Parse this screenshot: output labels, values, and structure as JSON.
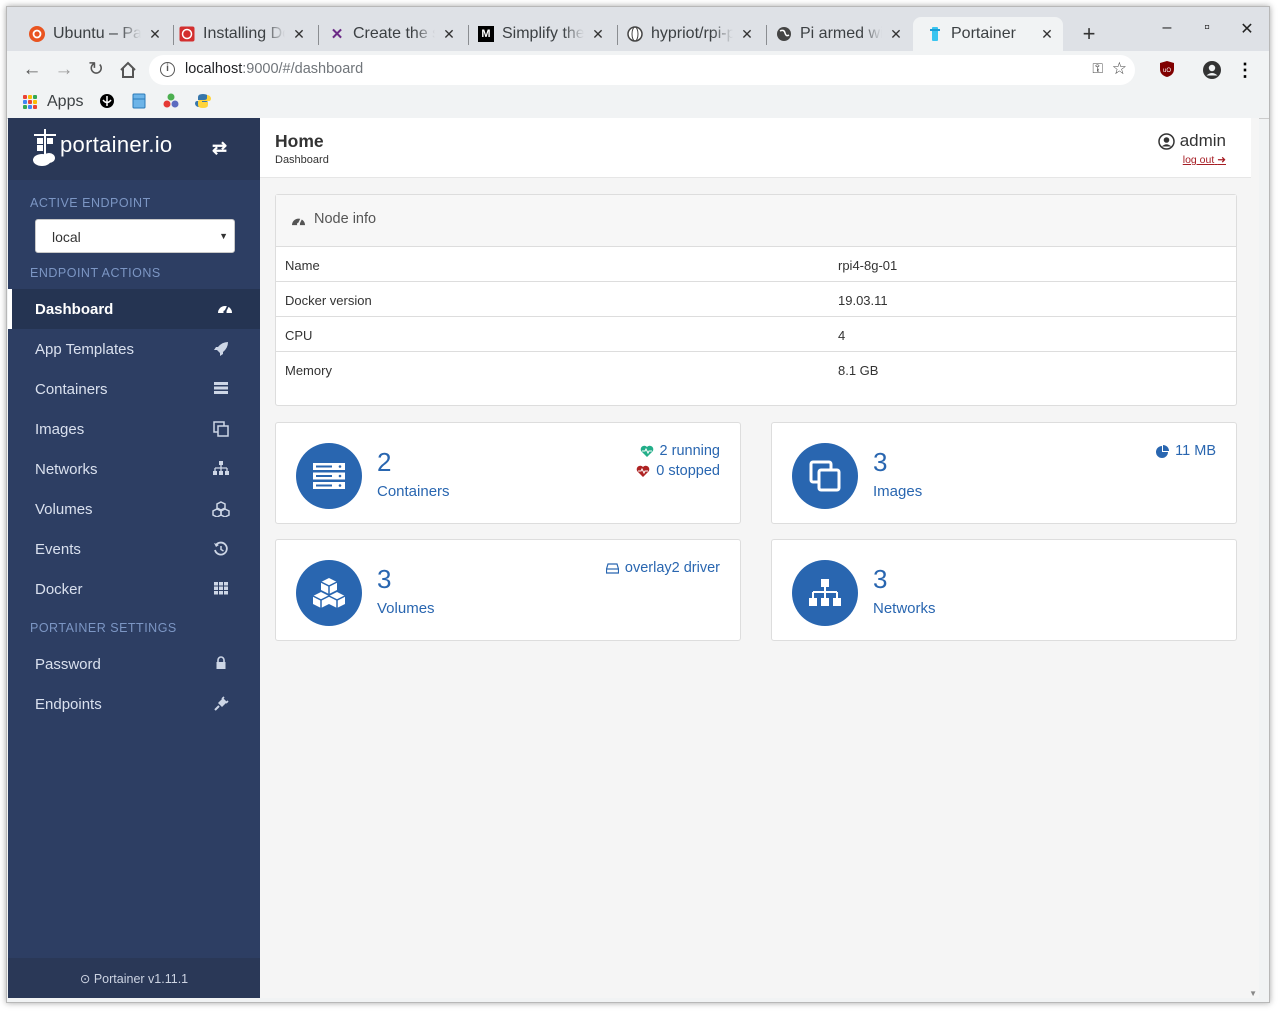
{
  "browser": {
    "tabs": [
      {
        "title": "Ubuntu – Pa",
        "icon": "ubuntu-icon"
      },
      {
        "title": "Installing Do",
        "icon": "block-icon"
      },
      {
        "title": "Create the sa",
        "icon": "x-logo-icon"
      },
      {
        "title": "Simplify the",
        "icon": "medium-icon"
      },
      {
        "title": "hypriot/rpi-p",
        "icon": "globe-icon"
      },
      {
        "title": "Pi armed wi",
        "icon": "globe-icon"
      },
      {
        "title": "Portainer",
        "icon": "portainer-icon"
      }
    ],
    "url_host": "localhost",
    "url_rest": ":9000/#/dashboard",
    "bookmarks": [
      {
        "label": "Apps"
      }
    ]
  },
  "sidebar": {
    "brand": "portainer.io",
    "active_endpoint_heading": "ACTIVE ENDPOINT",
    "endpoint_value": "local",
    "endpoint_actions_heading": "ENDPOINT ACTIONS",
    "items": [
      {
        "label": "Dashboard",
        "icon": "tachometer-icon"
      },
      {
        "label": "App Templates",
        "icon": "rocket-icon"
      },
      {
        "label": "Containers",
        "icon": "server-icon"
      },
      {
        "label": "Images",
        "icon": "clone-icon"
      },
      {
        "label": "Networks",
        "icon": "sitemap-icon"
      },
      {
        "label": "Volumes",
        "icon": "cubes-icon"
      },
      {
        "label": "Events",
        "icon": "history-icon"
      },
      {
        "label": "Docker",
        "icon": "th-icon"
      }
    ],
    "settings_heading": "PORTAINER SETTINGS",
    "settings_items": [
      {
        "label": "Password",
        "icon": "lock-icon"
      },
      {
        "label": "Endpoints",
        "icon": "plug-icon"
      }
    ],
    "footer": "Portainer v1.11.1"
  },
  "header": {
    "title": "Home",
    "subtitle": "Dashboard",
    "user": "admin",
    "logout": "log out"
  },
  "node_info": {
    "title": "Node info",
    "rows": [
      {
        "key": "Name",
        "value": "rpi4-8g-01"
      },
      {
        "key": "Docker version",
        "value": "19.03.11"
      },
      {
        "key": "CPU",
        "value": "4"
      },
      {
        "key": "Memory",
        "value": "8.1 GB"
      }
    ]
  },
  "tiles": {
    "containers": {
      "count": "2",
      "label": "Containers",
      "running": "2 running",
      "stopped": "0 stopped"
    },
    "images": {
      "count": "3",
      "label": "Images",
      "size": "11 MB"
    },
    "volumes": {
      "count": "3",
      "label": "Volumes",
      "driver": "overlay2 driver"
    },
    "networks": {
      "count": "3",
      "label": "Networks"
    }
  },
  "colors": {
    "sidebar": "#2d3e63",
    "accent": "#2966b0",
    "running": "#23ae89",
    "stopped": "#ae2323"
  }
}
